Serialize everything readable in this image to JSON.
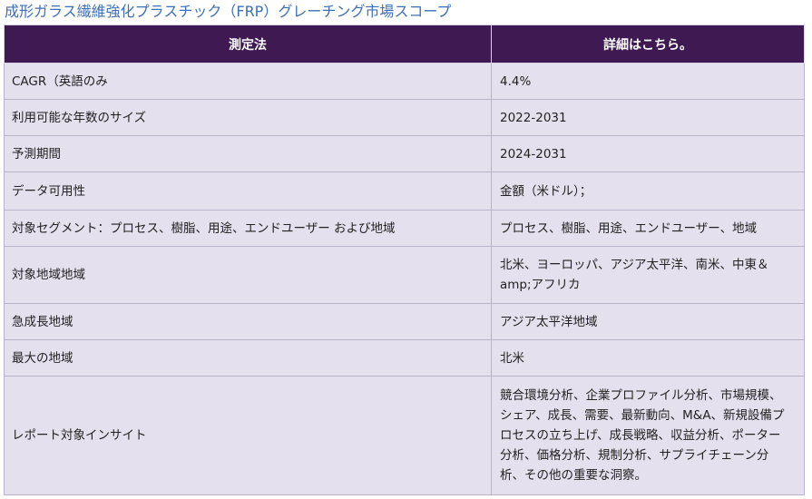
{
  "page": {
    "title": "成形ガラス繊維強化プラスチック（FRP）グレーチング市場スコープ"
  },
  "table": {
    "headers": {
      "metric": "測定法",
      "detail": "詳細はこちら。"
    },
    "rows": [
      {
        "metric": "CAGR（英語のみ",
        "detail": "4.4%"
      },
      {
        "metric": "利用可能な年数のサイズ",
        "detail": "2022-2031"
      },
      {
        "metric": "予測期間",
        "detail": "2024-2031"
      },
      {
        "metric": "データ可用性",
        "detail": "金額（米ドル）；"
      },
      {
        "metric": "対象セグメント：プロセス、樹脂、用途、エンドユーザー および地域",
        "detail": "プロセス、樹脂、用途、エンドユーザー、地域"
      },
      {
        "metric": "対象地域地域",
        "detail": "北米、ヨーロッパ、アジア太平洋、南米、中東＆amp;アフリカ"
      },
      {
        "metric": "急成長地域",
        "detail": "アジア太平洋地域"
      },
      {
        "metric": "最大の地域",
        "detail": "北米"
      },
      {
        "metric": "レポート対象インサイト",
        "detail": "競合環境分析、企業プロファイル分析、市場規模、シェア、成長、需要、最新動向、M&A、新規設備プロセスの立ち上げ、成長戦略、収益分析、ポーター分析、価格分析、規制分析、サプライチェーン分析、その他の重要な洞察。"
      }
    ]
  },
  "colors": {
    "title": "#3d6fb6",
    "header_bg": "#3f1a52",
    "header_text": "#ffffff",
    "row_bg": "#e4e0ee",
    "border": "#b9b2c8"
  }
}
